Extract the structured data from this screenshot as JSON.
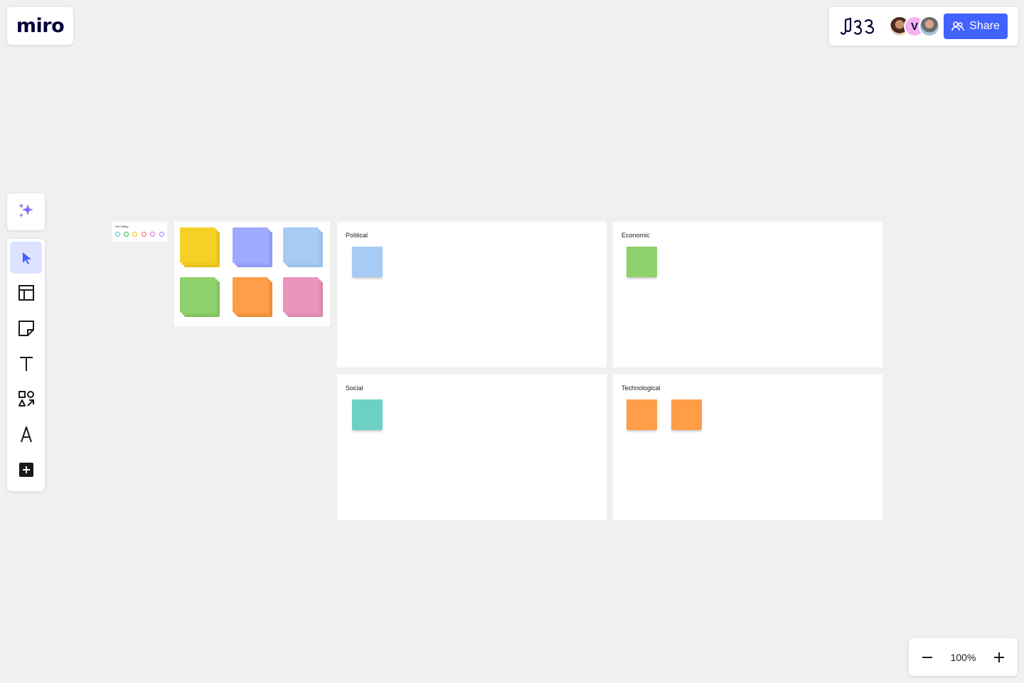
{
  "logo": {
    "text": "miro"
  },
  "header": {
    "share_label": "Share",
    "avatar_v_initial": "V"
  },
  "colors": {
    "accent": "#4262ff",
    "yellow": "#f5d128",
    "violet": "#9ea9ff",
    "light_blue": "#a6ccf5",
    "green": "#8fd16a",
    "orange": "#ff9d48",
    "pink": "#ea94bb",
    "teal": "#6cd0c5"
  },
  "left_toolbar": {
    "items": [
      {
        "icon": "select-cursor-icon",
        "active": true
      },
      {
        "icon": "templates-icon",
        "active": false
      },
      {
        "icon": "sticky-note-icon",
        "active": false
      },
      {
        "icon": "text-icon",
        "active": false
      },
      {
        "icon": "shapes-icon",
        "active": false
      },
      {
        "icon": "pen-icon",
        "active": false
      },
      {
        "icon": "add-more-icon",
        "active": false
      }
    ]
  },
  "zoom": {
    "level": "100%"
  },
  "canvas": {
    "dot_voting": {
      "title": "Dot Voting"
    },
    "frames": [
      {
        "id": "political",
        "title": "Political",
        "stickies": [
          "light_blue"
        ]
      },
      {
        "id": "economic",
        "title": "Economic",
        "stickies": [
          "green"
        ]
      },
      {
        "id": "social",
        "title": "Social",
        "stickies": [
          "teal"
        ]
      },
      {
        "id": "technological",
        "title": "Technological",
        "stickies": [
          "orange",
          "orange"
        ]
      }
    ]
  }
}
